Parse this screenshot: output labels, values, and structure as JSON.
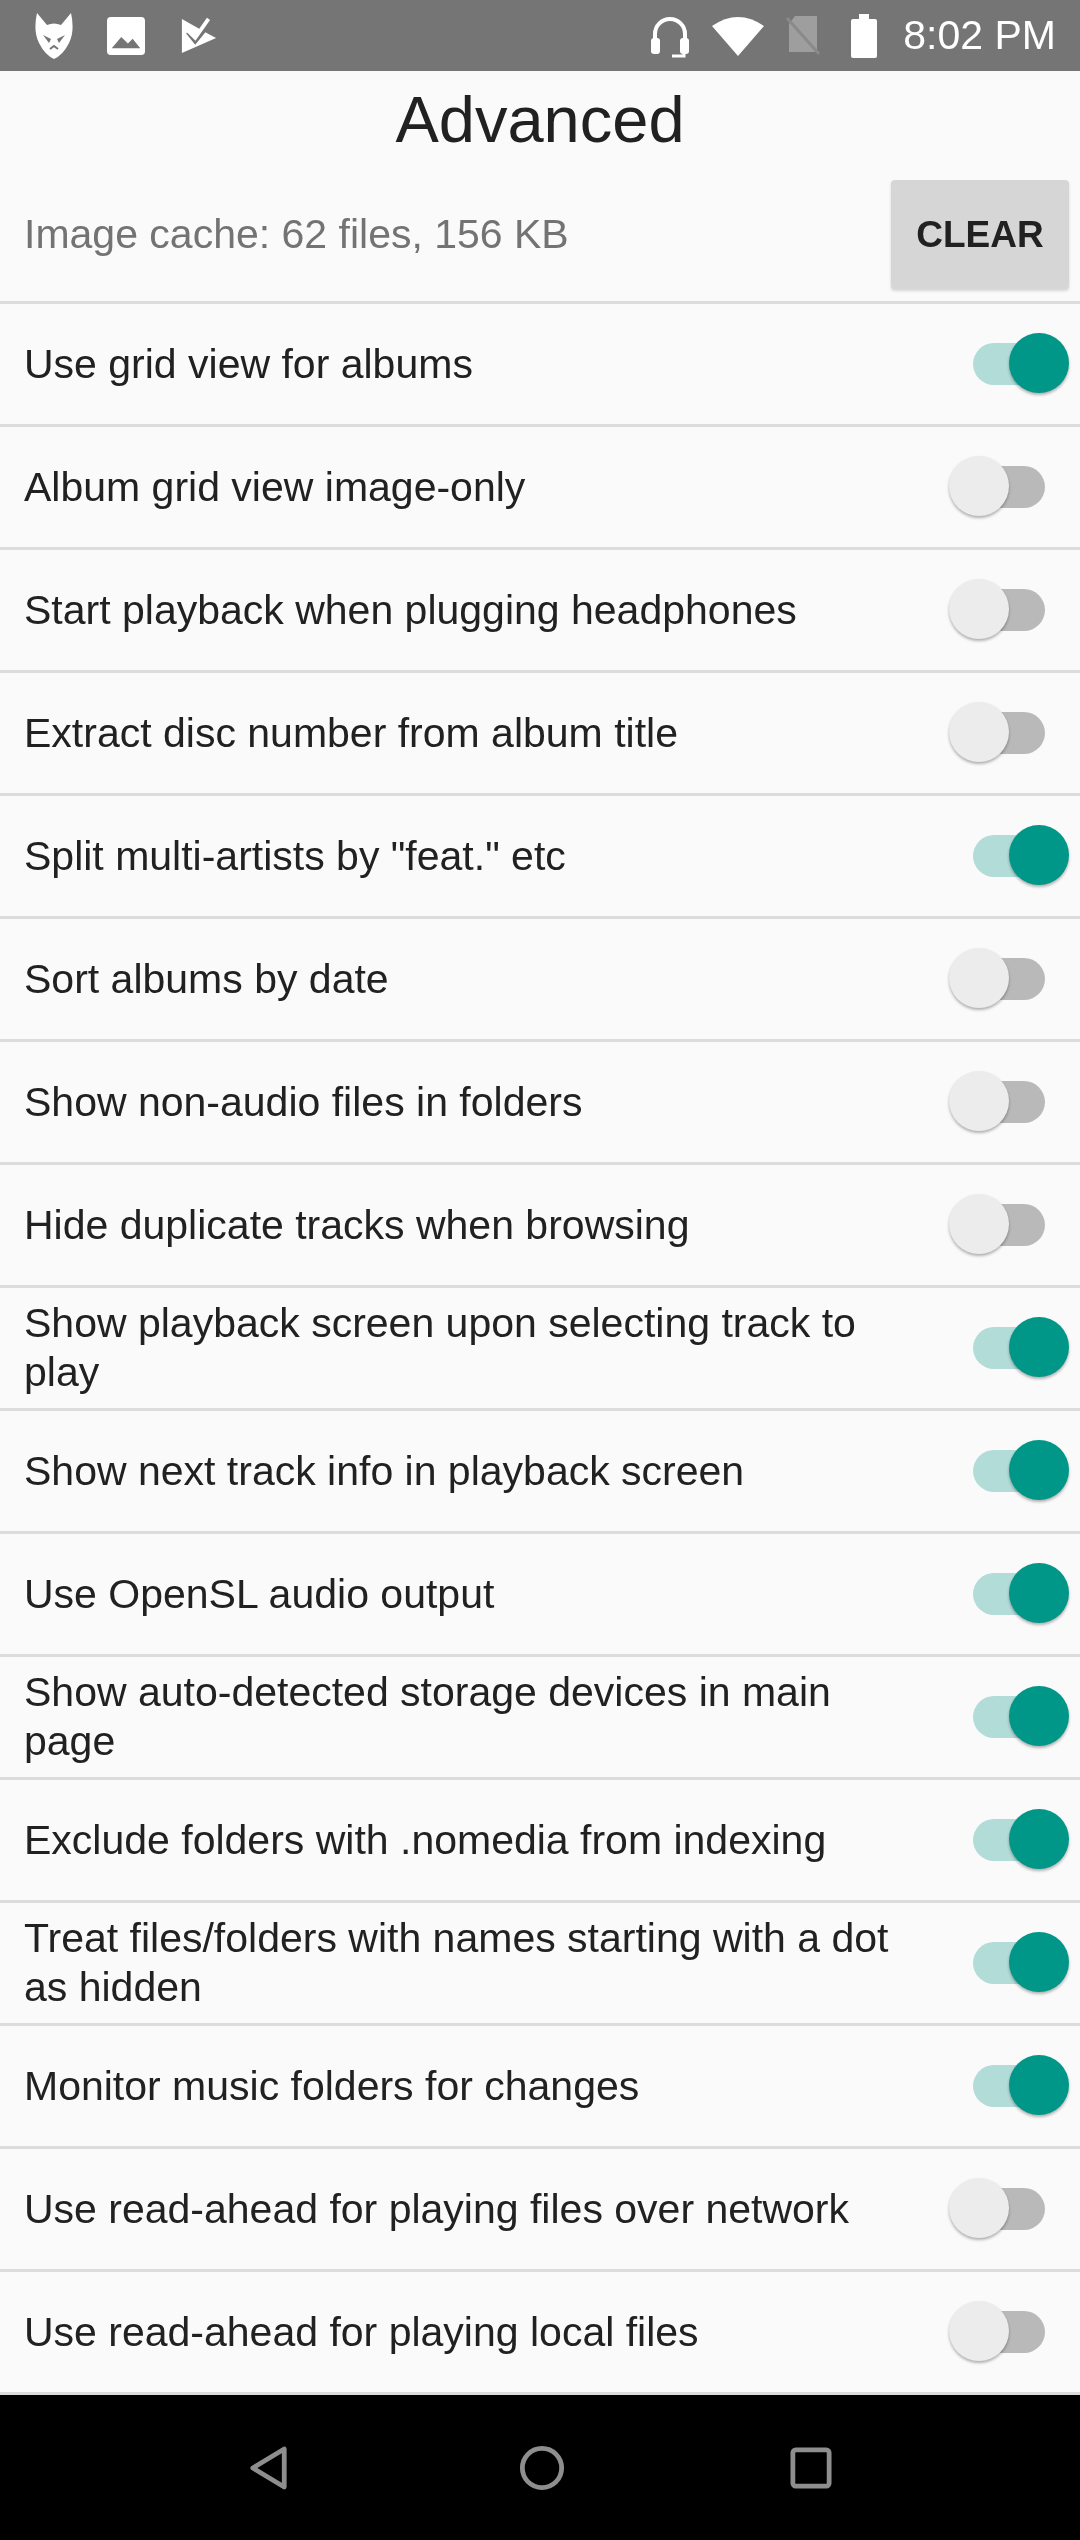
{
  "status_bar": {
    "time": "8:02 PM"
  },
  "title": "Advanced",
  "image_cache": {
    "label": "Image cache: 62 files, 156 KB",
    "button": "CLEAR"
  },
  "settings": [
    {
      "label": "Use grid view for albums",
      "on": true
    },
    {
      "label": "Album grid view image-only",
      "on": false
    },
    {
      "label": "Start playback when plugging headphones",
      "on": false
    },
    {
      "label": "Extract disc number from album title",
      "on": false
    },
    {
      "label": "Split multi-artists by \"feat.\" etc",
      "on": true
    },
    {
      "label": "Sort albums by date",
      "on": false
    },
    {
      "label": "Show non-audio files in folders",
      "on": false
    },
    {
      "label": "Hide duplicate tracks when browsing",
      "on": false
    },
    {
      "label": "Show playback screen upon selecting track to play",
      "on": true
    },
    {
      "label": "Show next track info in playback screen",
      "on": true
    },
    {
      "label": "Use OpenSL audio output",
      "on": true
    },
    {
      "label": "Show auto-detected storage devices in main page",
      "on": true
    },
    {
      "label": "Exclude folders with .nomedia from indexing",
      "on": true
    },
    {
      "label": "Treat files/folders with names starting with a dot as hidden",
      "on": true
    },
    {
      "label": "Monitor music folders for changes",
      "on": true
    },
    {
      "label": "Use read-ahead for playing files over network",
      "on": false
    },
    {
      "label": "Use read-ahead for playing local files",
      "on": false
    }
  ]
}
